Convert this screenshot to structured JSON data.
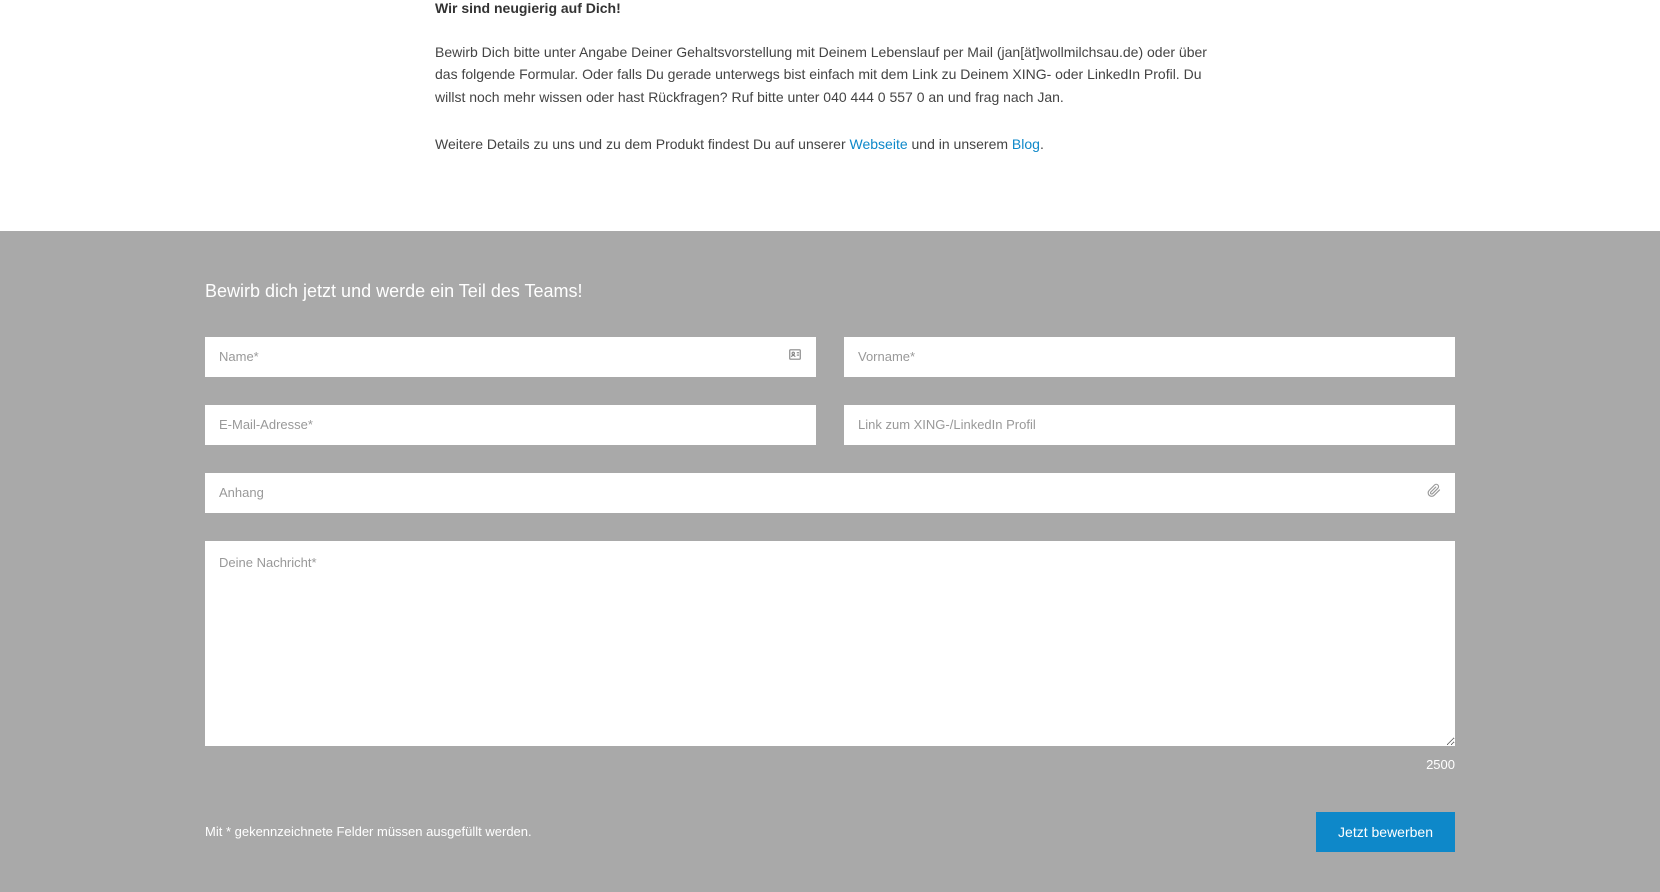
{
  "intro": {
    "heading": "Wir sind neugierig auf Dich!",
    "paragraph1": "Bewirb Dich bitte unter Angabe Deiner Gehaltsvorstellung mit Deinem Lebenslauf per Mail (jan[ät]wollmilchsau.de) oder über das folgende Formular. Oder falls Du gerade unterwegs bist einfach mit dem Link zu Deinem XING- oder LinkedIn Profil. Du willst noch mehr wissen oder hast Rückfragen? Ruf bitte unter 040 444 0 557 0 an und frag nach Jan.",
    "details_prefix": "Weitere Details zu uns und zu dem Produkt findest Du auf unserer ",
    "link_website": "Webseite",
    "details_mid": " und in unserem ",
    "link_blog": "Blog",
    "details_suffix": "."
  },
  "form": {
    "title": "Bewirb dich jetzt und werde ein Teil des Teams!",
    "placeholders": {
      "name": "Name*",
      "vorname": "Vorname*",
      "email": "E-Mail-Adresse*",
      "profile_link": "Link zum XING-/LinkedIn Profil",
      "attachment": "Anhang",
      "message": "Deine Nachricht*"
    },
    "char_limit": "2500",
    "required_note": "Mit * gekennzeichnete Felder müssen ausgefüllt werden.",
    "submit_label": "Jetzt bewerben"
  }
}
